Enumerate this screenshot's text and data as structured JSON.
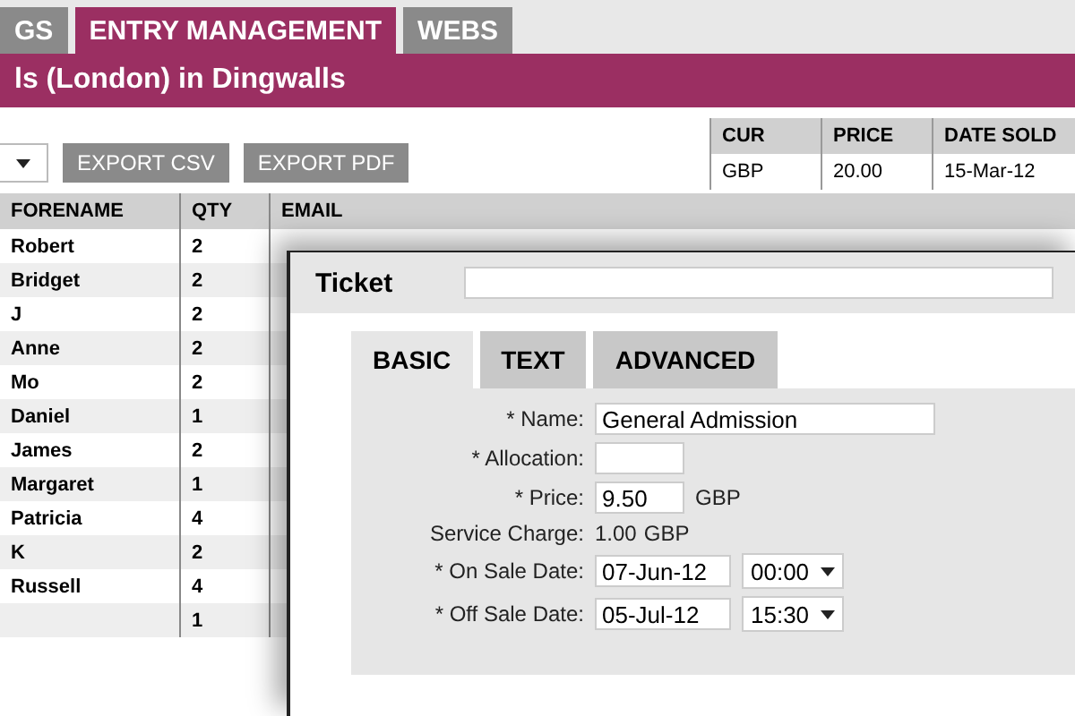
{
  "nav_tabs": [
    {
      "label": "GS",
      "selected": false
    },
    {
      "label": "ENTRY MANAGEMENT",
      "selected": true
    },
    {
      "label": "WEBS",
      "selected": false
    }
  ],
  "page_title": "ls (London) in Dingwalls",
  "toolbar": {
    "buttons": [
      "EXPORT CSV",
      "EXPORT PDF"
    ]
  },
  "sales_table": {
    "columns": [
      "CUR",
      "PRICE",
      "DATE SOLD"
    ],
    "row": [
      "GBP",
      "20.00",
      "15-Mar-12"
    ]
  },
  "entries_table": {
    "columns": [
      "FORENAME",
      "QTY",
      "EMAIL"
    ],
    "rows": [
      {
        "forename": "Robert",
        "qty": "2"
      },
      {
        "forename": "Bridget",
        "qty": "2"
      },
      {
        "forename": "J",
        "qty": "2"
      },
      {
        "forename": "Anne",
        "qty": "2"
      },
      {
        "forename": "Mo",
        "qty": "2"
      },
      {
        "forename": "Daniel",
        "qty": "1"
      },
      {
        "forename": "James",
        "qty": "2"
      },
      {
        "forename": "Margaret",
        "qty": "1"
      },
      {
        "forename": "Patricia",
        "qty": "4"
      },
      {
        "forename": "K",
        "qty": "2"
      },
      {
        "forename": "Russell",
        "qty": "4"
      },
      {
        "qty": "1"
      }
    ]
  },
  "dialog": {
    "title": "Ticket",
    "tabs": [
      {
        "label": "BASIC",
        "selected": true
      },
      {
        "label": "TEXT",
        "selected": false
      },
      {
        "label": "ADVANCED",
        "selected": false
      }
    ],
    "fields": [
      {
        "kind": "text",
        "label": "* Name:",
        "value": "General Admission"
      },
      {
        "kind": "text",
        "label": "* Allocation:"
      },
      {
        "kind": "money",
        "label": "* Price:",
        "value": "9.50",
        "unit": "GBP"
      },
      {
        "kind": "static",
        "label": "Service Charge:",
        "value": "1.00",
        "unit": "GBP"
      },
      {
        "kind": "datetime",
        "label": "* On Sale Date:",
        "value": "07-Jun-12",
        "time": "00:00"
      },
      {
        "kind": "datetime",
        "label": "* Off Sale Date:",
        "value": "05-Jul-12",
        "time": "15:30"
      }
    ]
  }
}
